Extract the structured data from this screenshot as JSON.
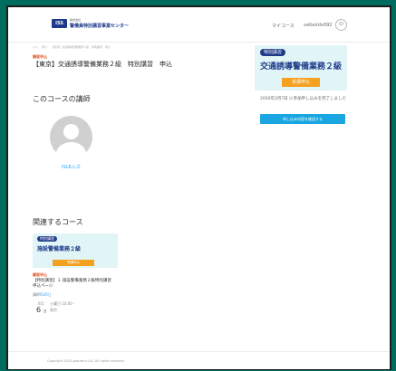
{
  "header": {
    "logo_mark": "ISS",
    "logo_sub": "株式会社",
    "logo_main": "警備員特別講習事業センター",
    "nav_mycourse": "マイコース",
    "nav_user": "veltairdv092"
  },
  "breadcrumb": [
    "マイ",
    "受付",
    "【東京】交通誘導警備業務２級　特別講習　申込"
  ],
  "course": {
    "mode": "講習申込",
    "title": "【東京】交通誘導警備業務２級　特別講習　申込"
  },
  "instructor_section": {
    "heading": "このコースの講師",
    "name": "ISLR入江"
  },
  "signup_card": {
    "badge": "特別講習",
    "banner_title": "交通誘導警備業務２級",
    "banner_button": "受講申込",
    "note": "2020年2月7日 に参加申し込みを完了しました",
    "confirm_button": "申し込み内容を確認する"
  },
  "related_section": {
    "heading": "関連するコース",
    "course": {
      "badge": "特別講習",
      "banner_title": "施設警備業務２級",
      "banner_button": "受講申込",
      "mode": "講習申込",
      "title": "【特別講習】１.施設警備業務２級特別講習　申込ページ",
      "instructor_label": "講師",
      "instructor": "ISLR江",
      "month": "6月",
      "day": "6",
      "day_suffix": "日",
      "time": "土曜日 10:00 -",
      "place": "東京"
    }
  },
  "footer": {
    "copyright": "Copyright 2020 gakuen-k.OA. All rights reserved."
  }
}
